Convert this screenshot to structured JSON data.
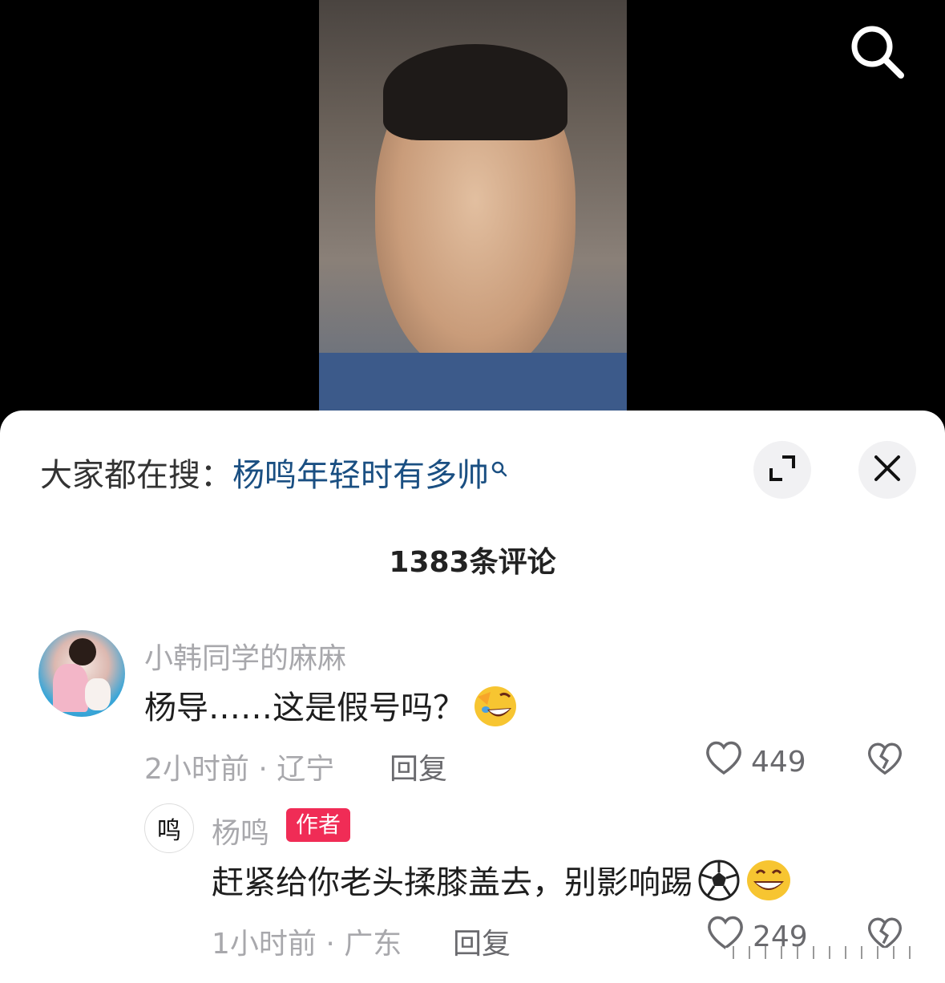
{
  "hot_search": {
    "prefix": "大家都在搜：",
    "term": "杨鸣年轻时有多帅"
  },
  "comments_header": {
    "count_label": "1383条评论"
  },
  "comments": [
    {
      "username": "小韩同学的麻麻",
      "text": "杨导……这是假号吗？",
      "emoji": "laughing-crying-emoji",
      "meta": "2小时前 · 辽宁",
      "reply_label": "回复",
      "likes": "449"
    }
  ],
  "reply": {
    "avatar_text": "鸣",
    "username": "杨鸣",
    "badge": "作者",
    "text": "赶紧给你老头揉膝盖去，别影响踢",
    "emojis": [
      "soccer-ball-emoji",
      "grinning-emoji"
    ],
    "meta": "1小时前 · 广东",
    "reply_label": "回复",
    "likes": "249"
  },
  "colors": {
    "accent_link": "#1a4f82",
    "author_badge": "#f02c56",
    "muted_text": "#a8a8ac",
    "sheet_bg": "#ffffff"
  },
  "icons": [
    "search-icon",
    "expand-icon",
    "close-icon",
    "heart-icon",
    "dislike-heart-icon"
  ]
}
